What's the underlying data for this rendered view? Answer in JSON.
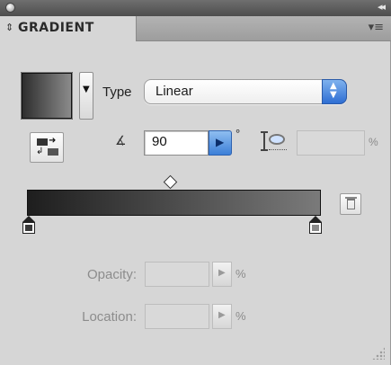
{
  "window": {
    "collapse_icon": "double-chevron-icon"
  },
  "panel": {
    "tab_label": "GRADIENT",
    "tab_icon": "up-down-arrows-icon",
    "menu_icon": "panel-menu-icon"
  },
  "type": {
    "label": "Type",
    "value": "Linear"
  },
  "angle": {
    "value": "90",
    "unit": "°"
  },
  "aspect": {
    "value": "",
    "unit": "%"
  },
  "gradient": {
    "start_color": "#1e1e1e",
    "end_color": "#7a7a7a",
    "midpoint_percent": 50
  },
  "opacity": {
    "label": "Opacity:",
    "value": "",
    "unit": "%"
  },
  "location": {
    "label": "Location:",
    "value": "",
    "unit": "%"
  }
}
